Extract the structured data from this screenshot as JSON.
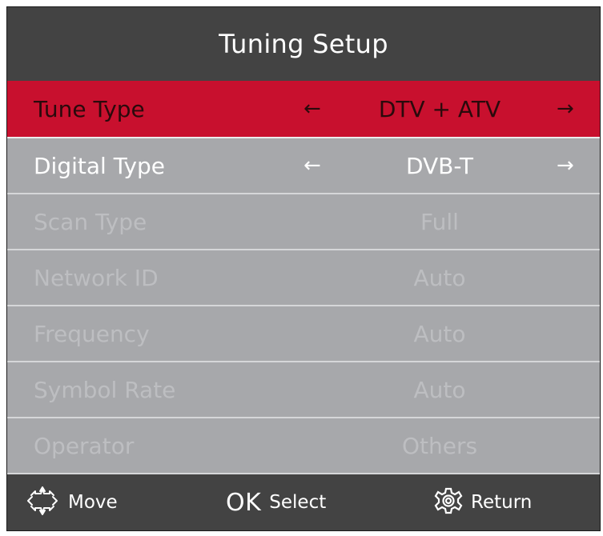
{
  "title": "Tuning Setup",
  "rows": [
    {
      "label": "Tune Type",
      "value": "DTV + ATV",
      "left_arrow": "←",
      "right_arrow": "→"
    },
    {
      "label": "Digital Type",
      "value": "DVB-T",
      "left_arrow": "←",
      "right_arrow": "→"
    },
    {
      "label": "Scan Type",
      "value": "Full"
    },
    {
      "label": "Network ID",
      "value": "Auto"
    },
    {
      "label": "Frequency",
      "value": "Auto"
    },
    {
      "label": "Symbol Rate",
      "value": "Auto"
    },
    {
      "label": "Operator",
      "value": "Others"
    }
  ],
  "footer": {
    "move_label": "Move",
    "ok_label": "OK",
    "select_label": "Select",
    "return_label": "Return"
  },
  "colors": {
    "title_bar": "#434343",
    "panel": "#a7a8ab",
    "selected_row": "#c8102e",
    "disabled_text": "#bdbec1"
  }
}
